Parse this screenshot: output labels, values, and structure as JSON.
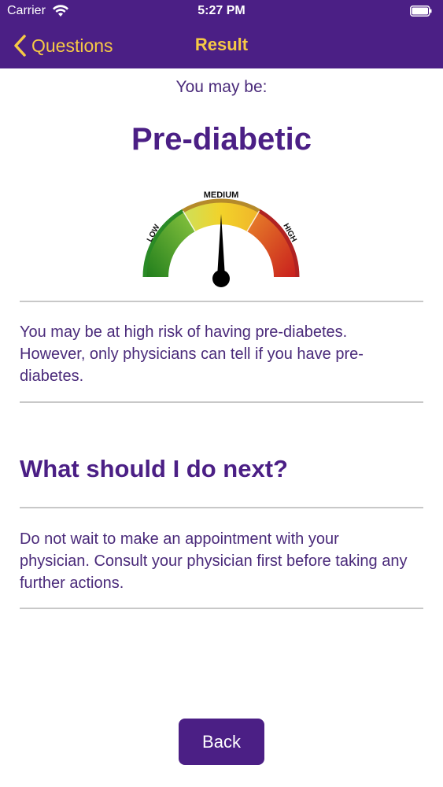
{
  "status_bar": {
    "carrier": "Carrier",
    "time": "5:27 PM",
    "icons": [
      "wifi-icon",
      "battery-icon"
    ]
  },
  "nav": {
    "back_label": "Questions",
    "title": "Result",
    "back_icon": "chevron-left-icon"
  },
  "result": {
    "intro": "You may be:",
    "title": "Pre-diabetic"
  },
  "gauge": {
    "labels": {
      "low": "LOW",
      "medium": "MEDIUM",
      "high": "HIGH"
    },
    "level": "medium"
  },
  "description": "You may be at high risk of having pre-diabetes. However, only physicians can tell if you have pre-diabetes.",
  "next_steps": {
    "heading": "What should I do next?",
    "body": "Do not wait to make an appointment with your physician. Consult your physician first before taking any further actions."
  },
  "footer": {
    "back_button": "Back"
  },
  "colors": {
    "primary": "#4b1f85",
    "accent": "#f6c945",
    "text": "#4a2a7a",
    "gauge_low": "#2e9a2a",
    "gauge_medium": "#e8c21a",
    "gauge_high": "#d9321f"
  }
}
